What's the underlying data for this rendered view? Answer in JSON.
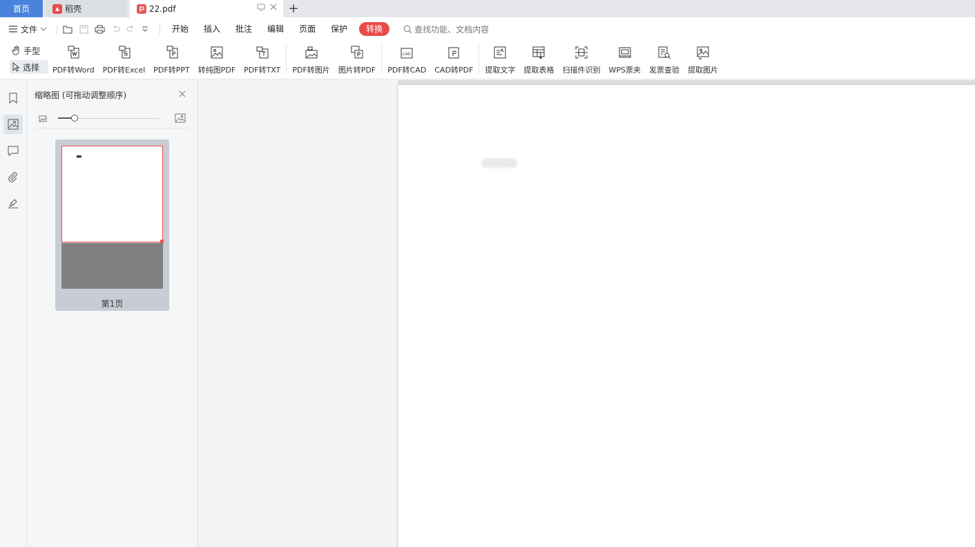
{
  "tabs": {
    "home": "首页",
    "daoke": "稻壳",
    "doc": "22.pdf"
  },
  "menu": {
    "file": "文件",
    "tabs": [
      "开始",
      "插入",
      "批注",
      "编辑",
      "页面",
      "保护",
      "转换"
    ],
    "active_tab": "转换",
    "search": "查找功能、文档内容"
  },
  "toolbar": {
    "mode_hand": "手型",
    "mode_select": "选择",
    "tools": [
      {
        "label": "PDF转Word",
        "icon": "pdf-to-word-icon"
      },
      {
        "label": "PDF转Excel",
        "icon": "pdf-to-excel-icon"
      },
      {
        "label": "PDF转PPT",
        "icon": "pdf-to-ppt-icon"
      },
      {
        "label": "转纯图PDF",
        "icon": "image-pdf-icon"
      },
      {
        "label": "PDF转TXT",
        "icon": "pdf-to-txt-icon"
      },
      {
        "label": "PDF转图片",
        "icon": "pdf-to-image-icon"
      },
      {
        "label": "图片转PDF",
        "icon": "image-to-pdf-icon"
      },
      {
        "label": "PDF转CAD",
        "icon": "pdf-to-cad-icon"
      },
      {
        "label": "CAD转PDF",
        "icon": "cad-to-pdf-icon"
      },
      {
        "label": "提取文字",
        "icon": "extract-text-icon"
      },
      {
        "label": "提取表格",
        "icon": "extract-table-icon"
      },
      {
        "label": "扫描件识别",
        "icon": "scan-recognize-icon"
      },
      {
        "label": "WPS票夹",
        "icon": "ticket-folder-icon"
      },
      {
        "label": "发票查验",
        "icon": "invoice-check-icon"
      },
      {
        "label": "提取图片",
        "icon": "extract-image-icon"
      }
    ]
  },
  "thumbnail_panel": {
    "title": "缩略图 (可拖动调整顺序)",
    "page_label": "第1页"
  },
  "colors": {
    "accent_red": "#e94b4b",
    "home_tab_blue": "#4a83dd"
  }
}
